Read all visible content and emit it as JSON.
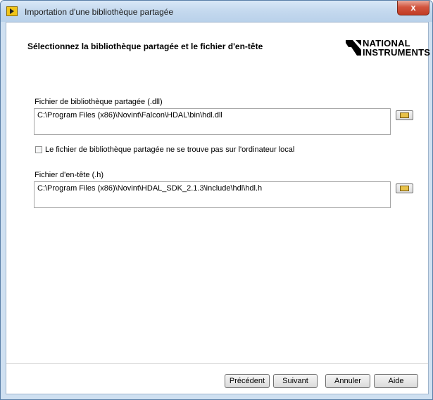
{
  "window": {
    "title": "Importation d'une bibliothèque partagée",
    "close_glyph": "x"
  },
  "header": {
    "title": "Sélectionnez la bibliothèque partagée et le fichier d'en-tête",
    "logo_line1": "NATIONAL",
    "logo_line2": "INSTRUMENTS",
    "logo_mark": "eagle-logo"
  },
  "dll": {
    "label": "Fichier de bibliothèque partagée (.dll)",
    "path": "C:\\Program Files (x86)\\Novint\\Falcon\\HDAL\\bin\\hdl.dll",
    "browse_icon": "folder-open-icon"
  },
  "checkbox": {
    "label": "Le fichier de bibliothèque partagée ne se trouve pas sur l'ordinateur local",
    "checked": false
  },
  "header_file": {
    "label": "Fichier d'en-tête (.h)",
    "path": "C:\\Program Files (x86)\\Novint\\HDAL_SDK_2.1.3\\include\\hdl\\hdl.h",
    "browse_icon": "folder-open-icon"
  },
  "buttons": {
    "previous": "Précédent",
    "next": "Suivant",
    "cancel": "Annuler",
    "help": "Aide"
  },
  "colors": {
    "titlebar": "#c4d9ee",
    "close": "#c13b23",
    "logo": "#000000"
  }
}
